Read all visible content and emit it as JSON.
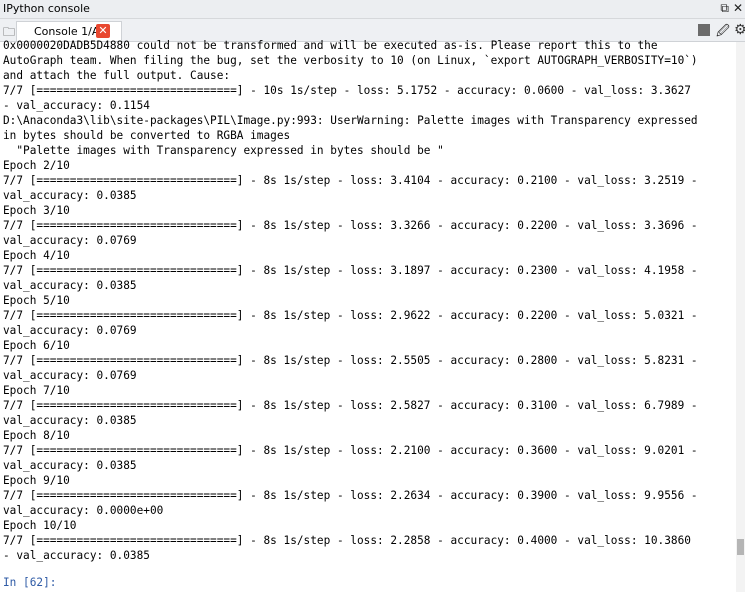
{
  "window": {
    "title": "IPython console",
    "icons": [
      "undock-icon",
      "close-icon"
    ]
  },
  "tab": {
    "label": "Console 1/A",
    "close_symbol": "✕"
  },
  "toolbar": {
    "icons": [
      "stop-icon",
      "eraser-icon",
      "gear-icon"
    ]
  },
  "console": {
    "lines": [
      "0x0000020DADB5D4880 could not be transformed and will be executed as-is. Please report this to the",
      "AutoGraph team. When filing the bug, set the verbosity to 10 (on Linux, `export AUTOGRAPH_VERBOSITY=10`)",
      "and attach the full output. Cause:",
      "7/7 [==============================] - 10s 1s/step - loss: 5.1752 - accuracy: 0.0600 - val_loss: 3.3627",
      "- val_accuracy: 0.1154",
      "D:\\Anaconda3\\lib\\site-packages\\PIL\\Image.py:993: UserWarning: Palette images with Transparency expressed",
      "in bytes should be converted to RGBA images",
      "  \"Palette images with Transparency expressed in bytes should be \"",
      "Epoch 2/10",
      "7/7 [==============================] - 8s 1s/step - loss: 3.4104 - accuracy: 0.2100 - val_loss: 3.2519 -",
      "val_accuracy: 0.0385",
      "Epoch 3/10",
      "7/7 [==============================] - 8s 1s/step - loss: 3.3266 - accuracy: 0.2200 - val_loss: 3.3696 -",
      "val_accuracy: 0.0769",
      "Epoch 4/10",
      "7/7 [==============================] - 8s 1s/step - loss: 3.1897 - accuracy: 0.2300 - val_loss: 4.1958 -",
      "val_accuracy: 0.0385",
      "Epoch 5/10",
      "7/7 [==============================] - 8s 1s/step - loss: 2.9622 - accuracy: 0.2200 - val_loss: 5.0321 -",
      "val_accuracy: 0.0769",
      "Epoch 6/10",
      "7/7 [==============================] - 8s 1s/step - loss: 2.5505 - accuracy: 0.2800 - val_loss: 5.8231 -",
      "val_accuracy: 0.0769",
      "Epoch 7/10",
      "7/7 [==============================] - 8s 1s/step - loss: 2.5827 - accuracy: 0.3100 - val_loss: 6.7989 -",
      "val_accuracy: 0.0385",
      "Epoch 8/10",
      "7/7 [==============================] - 8s 1s/step - loss: 2.2100 - accuracy: 0.3600 - val_loss: 9.0201 -",
      "val_accuracy: 0.0385",
      "Epoch 9/10",
      "7/7 [==============================] - 8s 1s/step - loss: 2.2634 - accuracy: 0.3900 - val_loss: 9.9556 -",
      "val_accuracy: 0.0000e+00",
      "Epoch 10/10",
      "7/7 [==============================] - 8s 1s/step - loss: 2.2858 - accuracy: 0.4000 - val_loss: 10.3860",
      "- val_accuracy: 0.0385"
    ],
    "prompt": "In [62]:",
    "prompt_color": "#2f5ba6"
  },
  "colors": {
    "close_button": "#e8472f",
    "titlebar_bg": "#eceef1"
  }
}
